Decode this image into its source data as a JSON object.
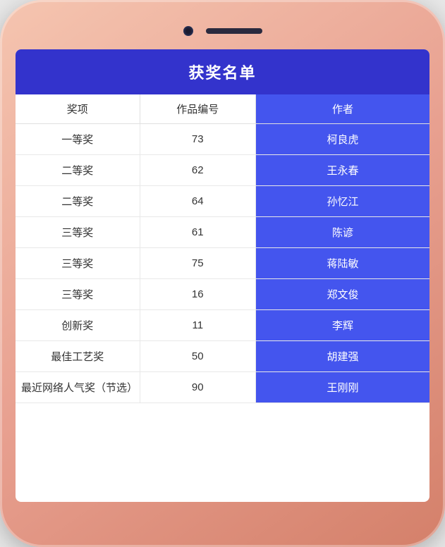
{
  "phone": {
    "title": "获奖名单"
  },
  "table": {
    "headers": {
      "prize": "奖项",
      "id": "作品编号",
      "author": "作者"
    },
    "rows": [
      {
        "prize": "一等奖",
        "id": "73",
        "author": "柯良虎"
      },
      {
        "prize": "二等奖",
        "id": "62",
        "author": "王永春"
      },
      {
        "prize": "二等奖",
        "id": "64",
        "author": "孙忆江"
      },
      {
        "prize": "三等奖",
        "id": "61",
        "author": "陈谚"
      },
      {
        "prize": "三等奖",
        "id": "75",
        "author": "蒋陆敏"
      },
      {
        "prize": "三等奖",
        "id": "16",
        "author": "郑文俊"
      },
      {
        "prize": "创新奖",
        "id": "11",
        "author": "李辉"
      },
      {
        "prize": "最佳工艺奖",
        "id": "50",
        "author": "胡建强"
      },
      {
        "prize": "最近网络人气奖（节选）",
        "id": "90",
        "author": "王刚刚"
      }
    ]
  }
}
